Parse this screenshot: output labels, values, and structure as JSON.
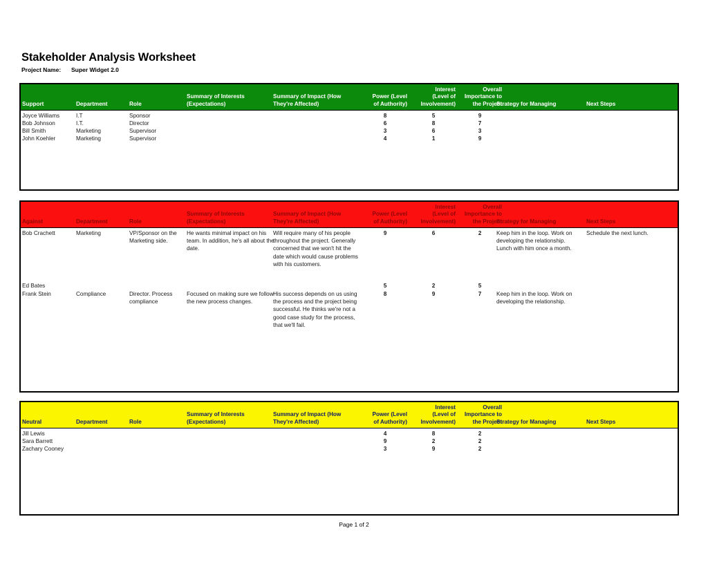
{
  "document": {
    "title": "Stakeholder Analysis Worksheet",
    "project_label": "Project Name:",
    "project_value": "Super Widget 2.0",
    "footer": "Page 1 of 2"
  },
  "colors": {
    "support_header_bg": "#0b8a0b",
    "support_header_text": "#ffffff",
    "against_header_bg": "#fb0f0f",
    "against_header_text": "#8f0707",
    "neutral_header_bg": "#fcf500",
    "neutral_header_text": "#0b1b6b",
    "border": "#000000"
  },
  "columns": {
    "department": "Department",
    "role": "Role",
    "interests": "Summary of Interests\n(Expectations)",
    "interests_l1": "Summary of Interests",
    "interests_l2": "(Expectations)",
    "impact_l1": "Summary of Impact (How",
    "impact_l2": "They're Affected)",
    "power_l1": "Power (Level",
    "power_l2": "of Authority)",
    "interest_l1": "Interest",
    "interest_l2": "(Level of",
    "interest_l3": "Involvement)",
    "overall_l1": "Overall",
    "overall_l2": "Importance to",
    "overall_l3": "the Project",
    "strategy": "Strategy for Managing",
    "next_steps": "Next Steps"
  },
  "sections": [
    {
      "id": "support",
      "label": "Support",
      "rows": [
        {
          "name": "Joyce Williams",
          "department": "I.T",
          "role": "Sponsor",
          "interests": "",
          "impact": "",
          "power": "8",
          "interest": "5",
          "overall": "9",
          "strategy": "",
          "next_steps": ""
        },
        {
          "name": "Bob Johnson",
          "department": "I.T.",
          "role": "Director",
          "interests": "",
          "impact": "",
          "power": "6",
          "interest": "8",
          "overall": "7",
          "strategy": "",
          "next_steps": ""
        },
        {
          "name": "Bill Smith",
          "department": "Marketing",
          "role": "Supervisor",
          "interests": "",
          "impact": "",
          "power": "3",
          "interest": "6",
          "overall": "3",
          "strategy": "",
          "next_steps": ""
        },
        {
          "name": "John Koehler",
          "department": "Marketing",
          "role": "Supervisor",
          "interests": "",
          "impact": "",
          "power": "4",
          "interest": "1",
          "overall": "9",
          "strategy": "",
          "next_steps": ""
        }
      ]
    },
    {
      "id": "against",
      "label": "Against",
      "rows": [
        {
          "name": "Bob Crachett",
          "department": "Marketing",
          "role": "VP/Sponsor on the Marketing side.",
          "interests": "He wants minimal impact on his team. In addition, he's all about the date.",
          "impact": "Will require many of his people throughout the project. Generally concerned that we won't hit the date which would cause problems with his customers.",
          "power": "9",
          "interest": "6",
          "overall": "2",
          "strategy": "Keep him in the loop. Work on developing the relationship. Lunch with him once a month.",
          "next_steps": "Schedule the next lunch."
        },
        {
          "name": "Ed Bates",
          "department": "",
          "role": "",
          "interests": "",
          "impact": "",
          "power": "5",
          "interest": "2",
          "overall": "5",
          "strategy": "",
          "next_steps": ""
        },
        {
          "name": "Frank Stein",
          "department": "Compliance",
          "role": "Director. Process compliance",
          "interests": "Focused on making sure we follow the new process changes.",
          "impact": "His success depends on us using the process and the project being successful. He thinks we're not a good case study for the process, that we'll fail.",
          "power": "8",
          "interest": "9",
          "overall": "7",
          "strategy": "Keep him in the loop. Work on developing the relationship.",
          "next_steps": ""
        }
      ]
    },
    {
      "id": "neutral",
      "label": "Neutral",
      "rows": [
        {
          "name": "Jill Lewis",
          "department": "",
          "role": "",
          "interests": "",
          "impact": "",
          "power": "4",
          "interest": "8",
          "overall": "2",
          "strategy": "",
          "next_steps": ""
        },
        {
          "name": "Sara Barrett",
          "department": "",
          "role": "",
          "interests": "",
          "impact": "",
          "power": "9",
          "interest": "2",
          "overall": "2",
          "strategy": "",
          "next_steps": ""
        },
        {
          "name": "Zachary Cooney",
          "department": "",
          "role": "",
          "interests": "",
          "impact": "",
          "power": "3",
          "interest": "9",
          "overall": "2",
          "strategy": "",
          "next_steps": ""
        }
      ]
    }
  ]
}
